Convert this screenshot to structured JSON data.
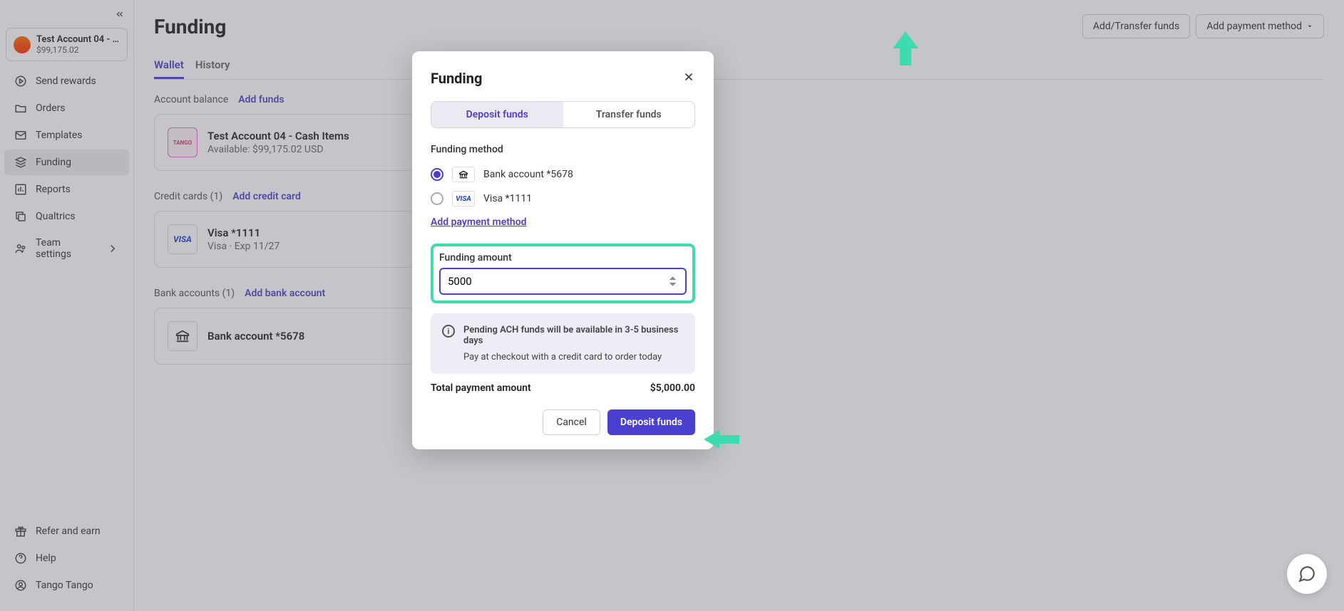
{
  "sidebar": {
    "account": {
      "name": "Test Account 04 - …",
      "balance": "$99,175.02"
    },
    "nav": [
      {
        "label": "Send rewards"
      },
      {
        "label": "Orders"
      },
      {
        "label": "Templates"
      },
      {
        "label": "Funding"
      },
      {
        "label": "Reports"
      },
      {
        "label": "Qualtrics"
      },
      {
        "label": "Team settings"
      }
    ],
    "bottom": [
      {
        "label": "Refer and earn"
      },
      {
        "label": "Help"
      },
      {
        "label": "Tango Tango"
      }
    ]
  },
  "header": {
    "title": "Funding",
    "add_transfer": "Add/Transfer funds",
    "add_payment": "Add payment method"
  },
  "tabs": {
    "wallet": "Wallet",
    "history": "History"
  },
  "account_balance": {
    "label": "Account balance",
    "add_funds": "Add funds",
    "card": {
      "title": "Test Account 04 - Cash Items",
      "subtitle": "Available: $99,175.02 USD",
      "icon_text": "TANGO"
    }
  },
  "credit_cards": {
    "label": "Credit cards (1)",
    "add": "Add credit card",
    "card": {
      "title": "Visa *1111",
      "subtitle": "Visa · Exp 11/27"
    }
  },
  "bank_accounts": {
    "label": "Bank accounts (1)",
    "add": "Add bank account",
    "card": {
      "title": "Bank account *5678"
    }
  },
  "modal": {
    "title": "Funding",
    "tabs": {
      "deposit": "Deposit funds",
      "transfer": "Transfer funds"
    },
    "method_label": "Funding method",
    "methods": [
      {
        "label": "Bank account *5678"
      },
      {
        "label": "Visa *1111"
      }
    ],
    "add_pm": "Add payment method",
    "amount_label": "Funding amount",
    "amount_value": "5000",
    "info_bold": "Pending ACH funds will be available in 3-5 business days",
    "info_sub": "Pay at checkout with a credit card to order today",
    "total_label": "Total payment amount",
    "total_value": "$5,000.00",
    "cancel": "Cancel",
    "deposit": "Deposit funds"
  },
  "visa_text": "VISA"
}
